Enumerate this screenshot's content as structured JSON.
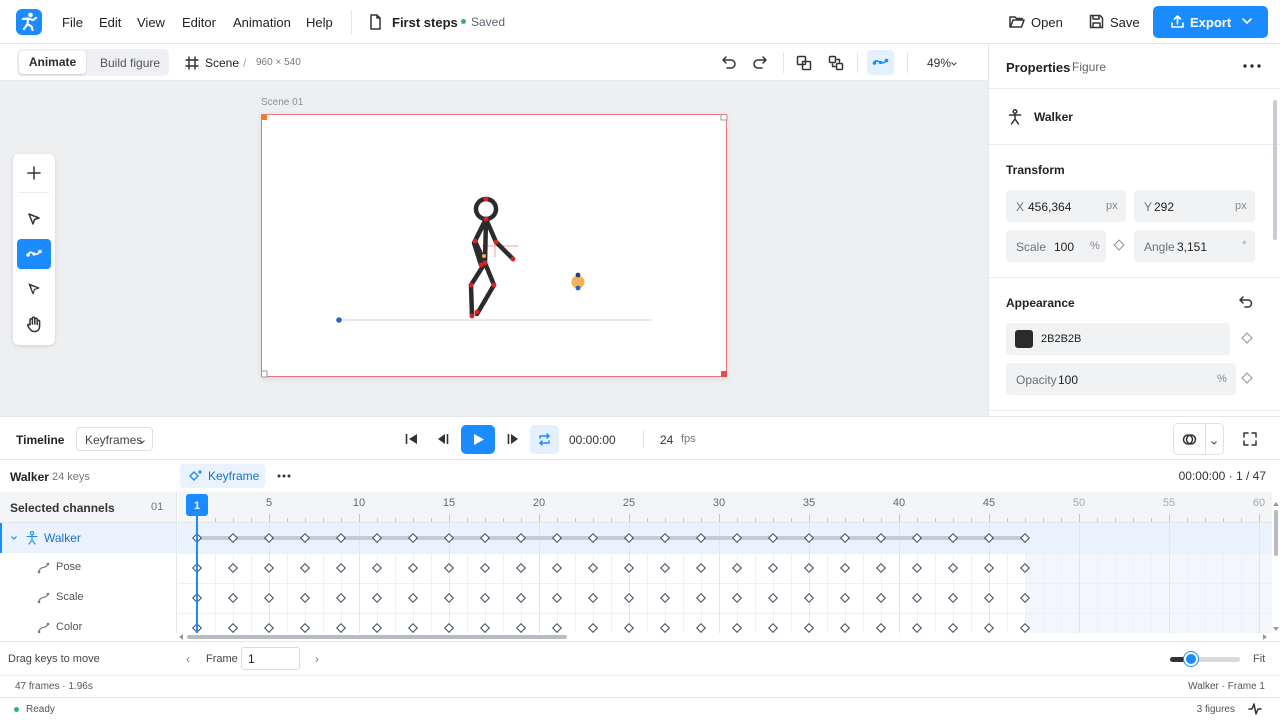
{
  "menu": [
    "File",
    "Edit",
    "View",
    "Editor",
    "Animation",
    "Help"
  ],
  "document": {
    "title": "First steps",
    "status": "Saved"
  },
  "actions": {
    "open": "Open",
    "save": "Save",
    "export": "Export"
  },
  "mode_toggle": {
    "active": "Animate",
    "inactive": "Build figure"
  },
  "scene_crumb": {
    "name": "Scene",
    "separator": "/",
    "size": "960 × 540"
  },
  "zoom": "49%",
  "scene_label": "Scene 01",
  "properties": {
    "title": "Properties",
    "subtitle": "Figure",
    "figure_name": "Walker",
    "transform": {
      "heading": "Transform",
      "x": {
        "label": "X",
        "value": "456,364",
        "unit": "px"
      },
      "y": {
        "label": "Y",
        "value": "292",
        "unit": "px"
      },
      "scale": {
        "label": "Scale",
        "value": "100",
        "unit": "%"
      },
      "angle": {
        "label": "Angle",
        "value": "3,151",
        "unit": "°"
      }
    },
    "appearance": {
      "heading": "Appearance",
      "color": {
        "value": "2B2B2B",
        "swatch": "#2b2b2b"
      },
      "opacity": {
        "label": "Opacity",
        "value": "100",
        "unit": "%"
      }
    }
  },
  "timeline": {
    "title": "Timeline",
    "view": "Keyframes",
    "time": "00:00:00",
    "fps_value": "24",
    "fps_unit": "fps",
    "layer_name": "Walker",
    "layer_keys": "24 keys",
    "keyframe_button": "Keyframe",
    "range": "00:00:00 · 1 / 47",
    "ruler": [
      "1",
      "5",
      "10",
      "15",
      "20",
      "25",
      "30",
      "35",
      "40",
      "45",
      "50",
      "55",
      "60"
    ],
    "current_frame": 1,
    "total_frames": 47,
    "channels_heading": "Selected channels",
    "channels_count": "01",
    "channels": [
      {
        "name": "Walker",
        "icon": "figure-icon"
      },
      {
        "name": "Pose",
        "icon": "curve-icon"
      },
      {
        "name": "Scale",
        "icon": "curve-icon"
      },
      {
        "name": "Color",
        "icon": "curve-icon"
      }
    ]
  },
  "frame_bar": {
    "hint": "Drag keys to move",
    "prev": "‹",
    "label": "Frame",
    "value": "1",
    "next": "›",
    "zoom_level": 0.3,
    "fit": "Fit"
  },
  "info": {
    "left": "47 frames · 1.96s",
    "right": "Walker · Frame 1"
  },
  "status": {
    "text": "Ready",
    "figures": "3 figures"
  },
  "colors": {
    "accent": "#1a8cff",
    "saved": "#2bb673",
    "scene_border": "#e6777f"
  }
}
